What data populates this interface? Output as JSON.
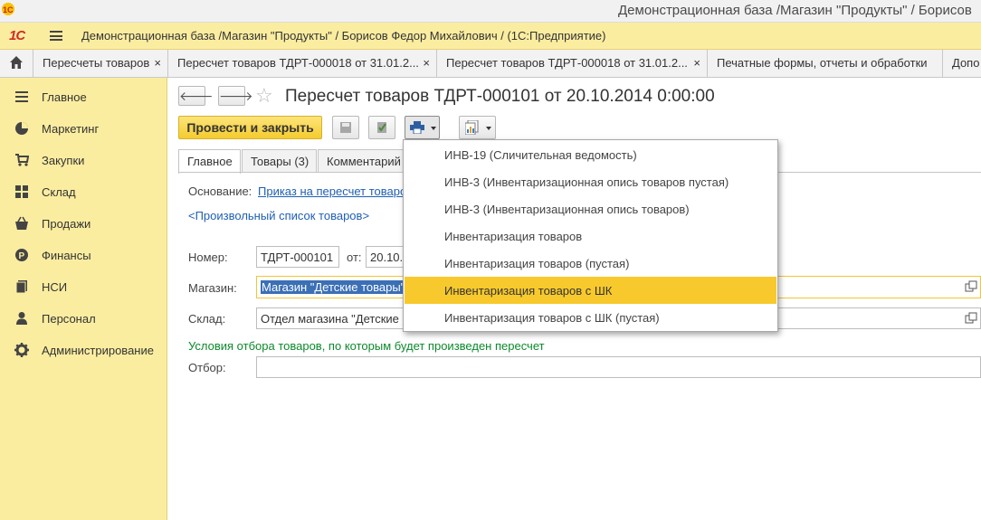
{
  "window": {
    "title": "Демонстрационная база /Магазин \"Продукты\" / Борисов"
  },
  "appbar": {
    "logo": "1С",
    "caption": "Демонстрационная база /Магазин \"Продукты\" / Борисов Федор Михайлович /  (1С:Предприятие)"
  },
  "tabs": [
    {
      "label": "Пересчеты товаров"
    },
    {
      "label": "Пересчет товаров ТДРТ-000018 от 31.01.2..."
    },
    {
      "label": "Пересчет товаров ТДРТ-000018 от 31.01.2..."
    },
    {
      "label": "Печатные формы, отчеты и обработки"
    },
    {
      "label": "Допо"
    }
  ],
  "tab_close_glyph": "×",
  "sidebar": {
    "items": [
      {
        "label": "Главное",
        "icon": "list-icon"
      },
      {
        "label": "Маркетинг",
        "icon": "pie-chart-icon"
      },
      {
        "label": "Закупки",
        "icon": "cart-icon"
      },
      {
        "label": "Склад",
        "icon": "warehouse-icon"
      },
      {
        "label": "Продажи",
        "icon": "basket-icon"
      },
      {
        "label": "Финансы",
        "icon": "coin-icon"
      },
      {
        "label": "НСИ",
        "icon": "documents-icon"
      },
      {
        "label": "Персонал",
        "icon": "person-icon"
      },
      {
        "label": "Администрирование",
        "icon": "gear-icon"
      }
    ]
  },
  "form": {
    "title": "Пересчет товаров ТДРТ-000101 от 20.10.2014 0:00:00",
    "post_and_close": "Провести и закрыть",
    "tabs": [
      {
        "label": "Главное"
      },
      {
        "label": "Товары (3)"
      },
      {
        "label": "Комментарий"
      }
    ],
    "basis_label": "Основание:",
    "basis_link": "Приказ на пересчет товаров",
    "arbitrary_list": "<Произвольный список товаров>",
    "number_label": "Номер:",
    "number_value": "ТДРТ-000101",
    "date_label": "от:",
    "date_value": "20.10.",
    "store_label": "Магазин:",
    "store_value": "Магазин \"Детские товары\"",
    "warehouse_label": "Склад:",
    "warehouse_value": "Отдел магазина \"Детские",
    "conditions_text": "Условия отбора товаров, по которым будет произведен пересчет",
    "filter_label": "Отбор:",
    "filter_value": ""
  },
  "print_menu": {
    "items": [
      {
        "label": "ИНВ-19 (Сличительная ведомость)"
      },
      {
        "label": "ИНВ-3 (Инвентаризационная опись товаров пустая)"
      },
      {
        "label": "ИНВ-3 (Инвентаризационная опись товаров)"
      },
      {
        "label": "Инвентаризация товаров"
      },
      {
        "label": "Инвентаризация товаров (пустая)"
      },
      {
        "label": "Инвентаризация товаров с ШК",
        "highlighted": true
      },
      {
        "label": "Инвентаризация товаров с ШК (пустая)"
      }
    ]
  },
  "colors": {
    "accent_yellow": "#fbeda0",
    "highlight": "#f8c92c",
    "link_blue": "#1f5fb5",
    "green_text": "#0b8a2b"
  }
}
